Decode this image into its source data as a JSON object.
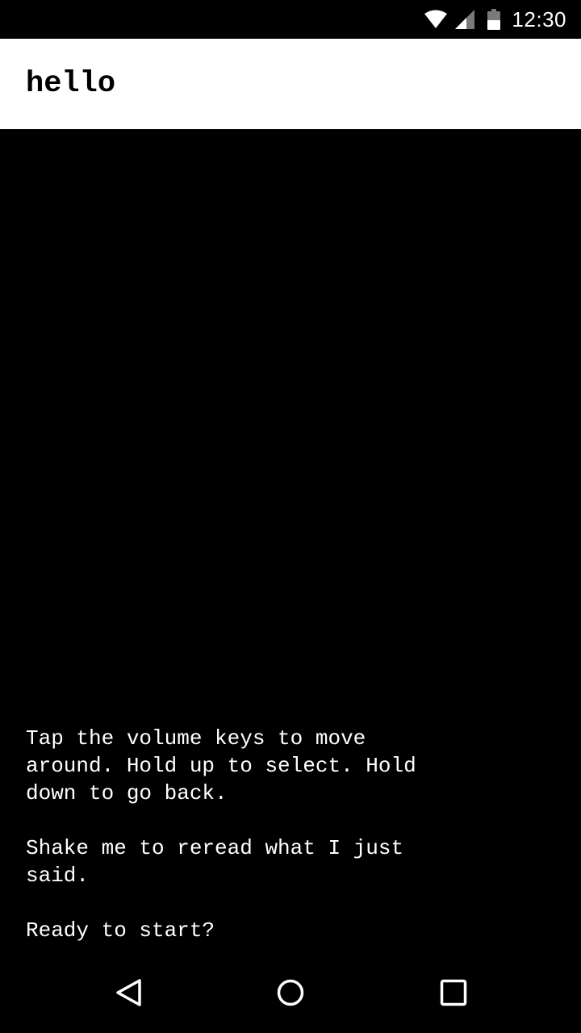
{
  "status_bar": {
    "time": "12:30",
    "icons": [
      "wifi-icon",
      "cell-signal-icon",
      "battery-icon"
    ]
  },
  "app_bar": {
    "title": "hello"
  },
  "content": {
    "message": "Tap the volume keys to move\naround. Hold up to select. Hold\ndown to go back.\n\nShake me to reread what I just\nsaid.\n\nReady to start?"
  },
  "nav_bar": {
    "buttons": [
      "back-icon",
      "home-icon",
      "recents-icon"
    ]
  },
  "colors": {
    "background": "#000000",
    "app_bar": "#ffffff",
    "text_on_dark": "#ffffff",
    "text_on_light": "#000000"
  }
}
